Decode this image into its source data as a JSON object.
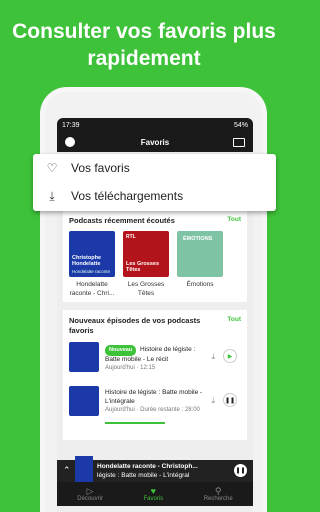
{
  "headline": {
    "line1": "Consulter vos favoris plus",
    "line2": "rapidement"
  },
  "status_bar": {
    "time": "17:39",
    "battery": "54%"
  },
  "app_bar": {
    "title": "Favoris"
  },
  "dropdown": {
    "items": [
      {
        "label": "Vos favoris",
        "icon": "heart-icon"
      },
      {
        "label": "Vos téléchargements",
        "icon": "download-icon"
      }
    ]
  },
  "recent_podcasts": {
    "title": "Podcasts récemment écoutés",
    "see_all": "Tout",
    "items": [
      {
        "caption": "Hondelatte raconte - Chri...",
        "art_title": "Christophe Hondelatte",
        "art_sub": "Hondelatte raconte",
        "color": "#1b3aa8"
      },
      {
        "caption": "Les Grosses Têtes",
        "art_title": "Les Grosses Têtes",
        "art_sub": "RTL",
        "color": "#b3141b"
      },
      {
        "caption": "Émotions",
        "art_title": "ÉMOTIONS",
        "art_sub": "",
        "color": "#7fc3a5"
      }
    ]
  },
  "new_episodes": {
    "title": "Nouveaux épisodes de vos podcasts favoris",
    "see_all": "Tout",
    "items": [
      {
        "badge": "Nouveau",
        "title": "Histoire de légiste : Batte mobile - Le récit",
        "meta": "Aujourd'hui · 12:15"
      },
      {
        "badge": "",
        "title": "Histoire de légiste : Batte mobile - L'intégrale",
        "meta": "Aujourd'hui · Durée restante : 28:00"
      }
    ]
  },
  "mini_player": {
    "title": "Hondelatte raconte - Christoph...",
    "subtitle": "légiste : Batte mobile - L'intégral"
  },
  "bottom_nav": {
    "items": [
      {
        "label": "Découvrir",
        "icon": "play-icon",
        "active": false
      },
      {
        "label": "Favoris",
        "icon": "heart-icon",
        "active": true
      },
      {
        "label": "Recherche",
        "icon": "search-icon",
        "active": false
      }
    ]
  },
  "colors": {
    "brand_green": "#3ec23a",
    "dark_bar": "#1a1a1a"
  }
}
